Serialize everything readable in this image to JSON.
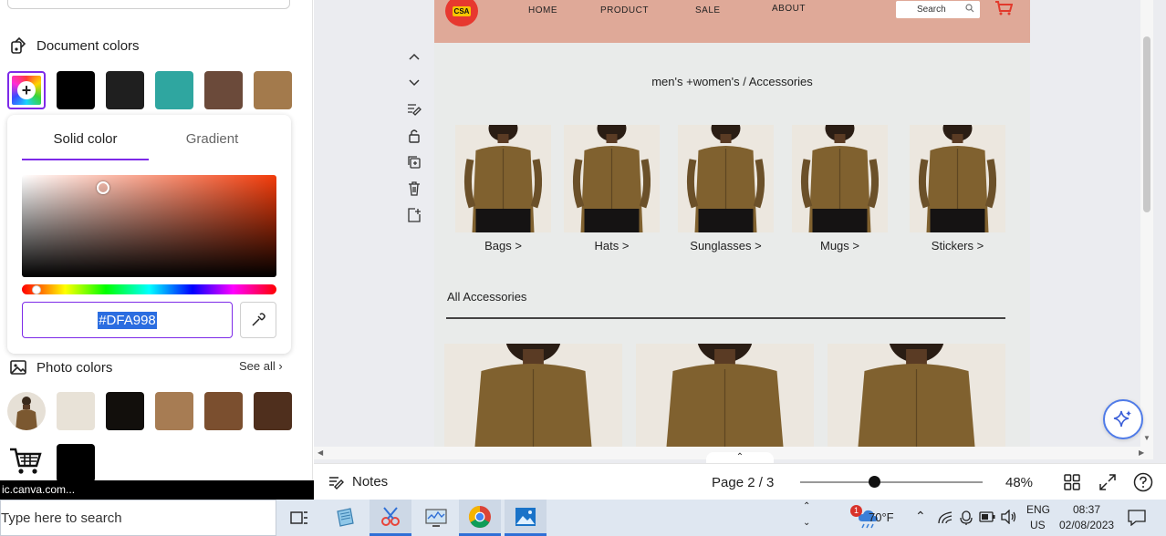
{
  "left_panel": {
    "document_colors_title": "Document colors",
    "document_colors": [
      "#000000",
      "#1f1f1f",
      "#2fa6a0",
      "#6b4a3a",
      "#a37a4c"
    ],
    "picker": {
      "tab_solid": "Solid color",
      "tab_gradient": "Gradient",
      "hex_value": "#DFA998"
    },
    "photo_colors_title": "Photo colors",
    "see_all": "See all",
    "photo_colors": [
      "#e8e2d7",
      "#120f0c",
      "#a77c53",
      "#7b4f2f",
      "#4f2f1d"
    ],
    "url_tooltip": "ic.canva.com..."
  },
  "site": {
    "logo_text": "CSA",
    "nav": [
      "HOME",
      "PRODUCT",
      "SALE",
      "ABOUT"
    ],
    "search_label": "Search",
    "breadcrumb": "men's +women's / Accessories",
    "categories": [
      "Bags >",
      "Hats >",
      "Sunglasses >",
      "Mugs >",
      "Stickers >"
    ],
    "all_accessories": "All Accessories",
    "bg_color": "#dfa998"
  },
  "editor": {
    "notes": "Notes",
    "page_info": "Page 2 / 3",
    "zoom": "48%",
    "zoom_fraction": 0.48
  },
  "taskbar": {
    "search_placeholder": "Type here to search",
    "weather_badge": "1",
    "temperature": "70°F",
    "lang_top": "ENG",
    "lang_bottom": "US",
    "time": "08:37",
    "date": "02/08/2023"
  }
}
